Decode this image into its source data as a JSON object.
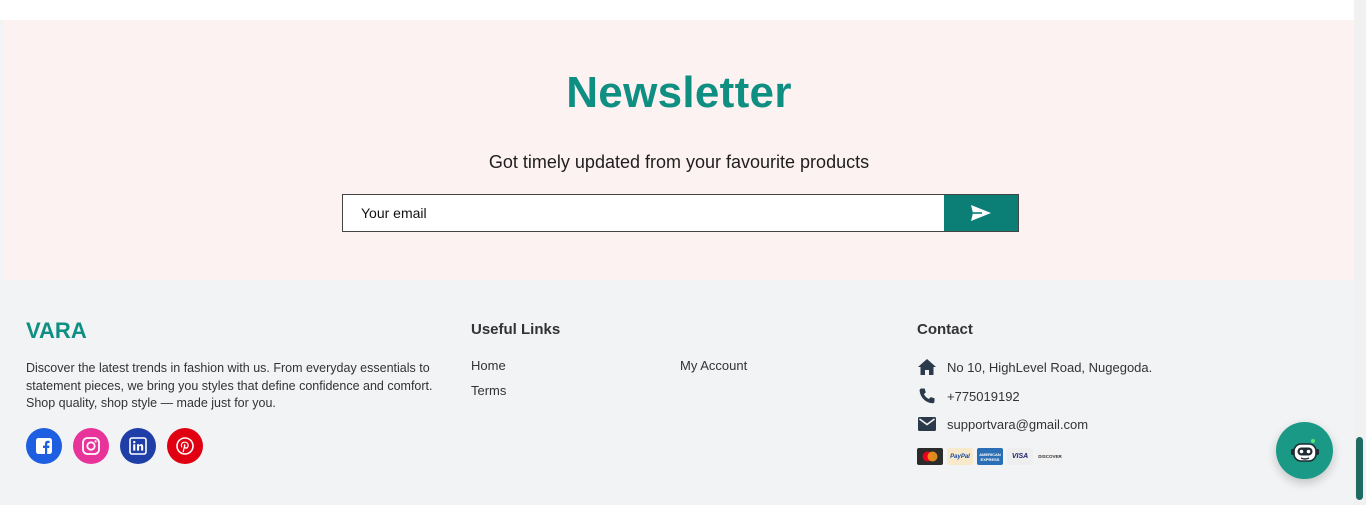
{
  "newsletter": {
    "title": "Newsletter",
    "subtitle": "Got timely updated from your favourite products",
    "email_placeholder": "Your email",
    "submit_icon": "send-icon"
  },
  "footer": {
    "brand": "VARA",
    "description": "Discover the latest trends in fashion with us. From everyday essentials to statement pieces, we bring you styles that define confidence and comfort. Shop quality, shop style — made just for you.",
    "social": [
      {
        "icon": "facebook-icon",
        "color": "#1d5fe0"
      },
      {
        "icon": "instagram-icon",
        "color": "#e8339a"
      },
      {
        "icon": "linkedin-icon",
        "color": "#1f3ea8"
      },
      {
        "icon": "pinterest-icon",
        "color": "#e00012"
      }
    ],
    "useful_links": {
      "title": "Useful Links",
      "items": [
        "Home",
        "Terms",
        "My Account"
      ]
    },
    "contact": {
      "title": "Contact",
      "address": "No 10, HighLevel Road, Nugegoda.",
      "phone": "+775019192",
      "email": "supportvara@gmail.com"
    },
    "payments": [
      {
        "icon": "mastercard-icon",
        "label": "MasterCard",
        "color": "#2b2b2b"
      },
      {
        "icon": "paypal-icon",
        "label": "PayPal",
        "color": "#f7e9c9"
      },
      {
        "icon": "amex-icon",
        "label": "AMERICAN EXPRESS",
        "color": "#2a6fb5"
      },
      {
        "icon": "visa-icon",
        "label": "VISA",
        "color": "#eeeeee"
      },
      {
        "icon": "discover-icon",
        "label": "DISCOVER",
        "color": "#f2f2f2"
      }
    ]
  },
  "colors": {
    "accent": "#0e8f82",
    "button": "#0b7f76",
    "newsletter_bg": "#fdf2f2",
    "footer_bg": "#f1f3f5"
  }
}
